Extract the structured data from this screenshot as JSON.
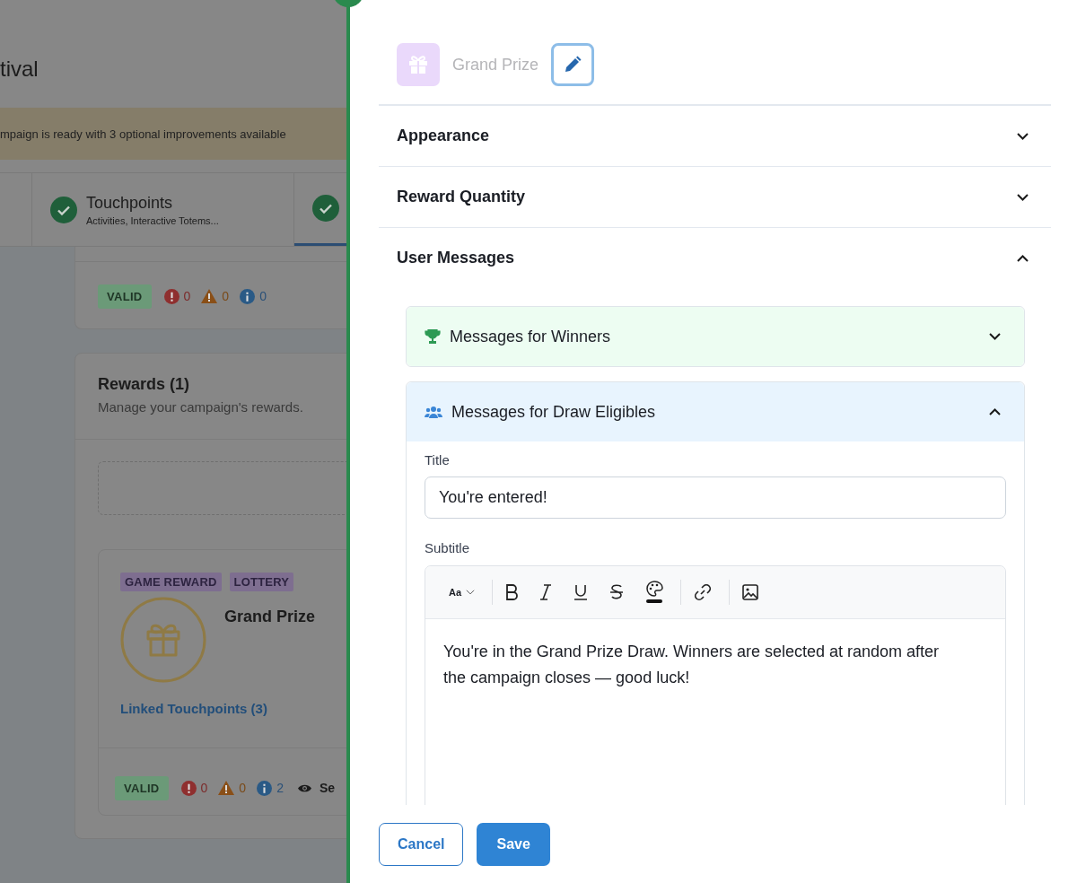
{
  "page": {
    "title": "tival",
    "banner": "mpaign is ready with 3 optional improvements available",
    "steps": [
      {
        "title": "Touchpoints",
        "subtitle": "Activities, Interactive Totems...",
        "complete": true,
        "selected": false
      },
      {
        "complete": true,
        "selected": true
      }
    ],
    "touchpoints_status": {
      "badge": "VALID",
      "errors": "0",
      "warnings": "0",
      "infos": "0"
    },
    "rewards": {
      "title": "Rewards (1)",
      "subtitle": "Manage your campaign's rewards.",
      "items": [
        {
          "tags": [
            "GAME REWARD",
            "LOTTERY"
          ],
          "name": "Grand Prize",
          "link": "Linked Touchpoints (3)",
          "status": {
            "badge": "VALID",
            "errors": "0",
            "warnings": "0",
            "infos": "2",
            "action": "Se"
          }
        }
      ]
    }
  },
  "panel": {
    "reward_name": "Grand Prize",
    "sections": [
      {
        "title": "Appearance",
        "expanded": false
      },
      {
        "title": "Reward Quantity",
        "expanded": false
      },
      {
        "title": "User Messages",
        "expanded": true,
        "groups": [
          {
            "kind": "winners",
            "title": "Messages for Winners",
            "expanded": false
          },
          {
            "kind": "eligibles",
            "title": "Messages for Draw Eligibles",
            "expanded": true,
            "fields": {
              "title_label": "Title",
              "title_value": "You're entered!",
              "subtitle_label": "Subtitle",
              "font_size_label": "Aa",
              "subtitle_value": "You're in the Grand Prize Draw. Winners are selected at random after the campaign closes — good luck!"
            }
          }
        ]
      }
    ],
    "buttons": [
      {
        "label": "Cancel",
        "kind": "secondary"
      },
      {
        "label": "Save",
        "kind": "primary"
      }
    ]
  }
}
